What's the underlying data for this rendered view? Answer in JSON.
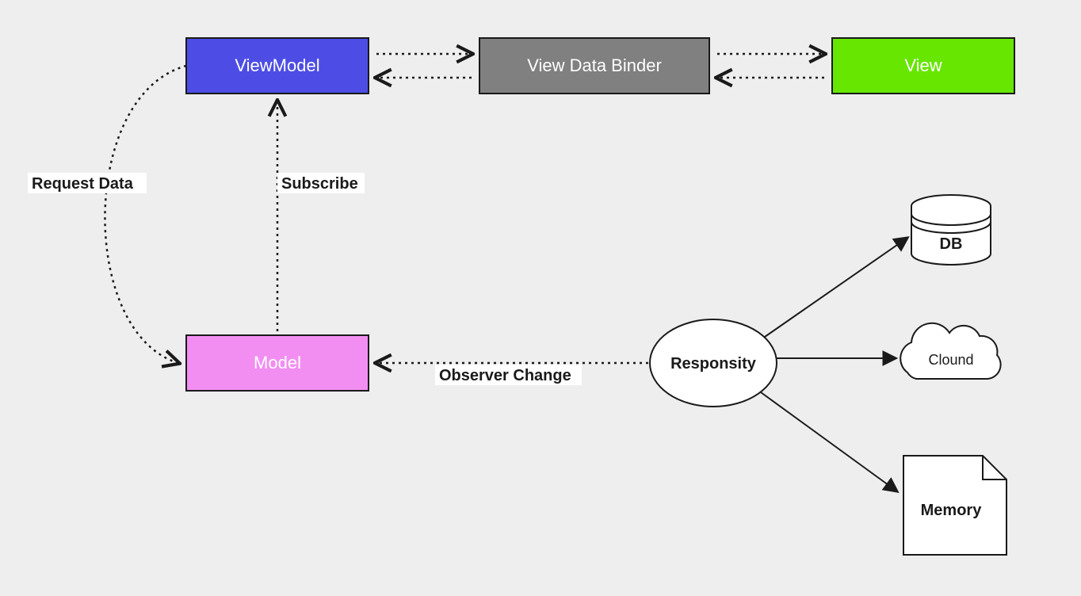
{
  "nodes": {
    "viewmodel": {
      "label": "ViewModel",
      "fill": "#4d4de6",
      "text": "#ffffff"
    },
    "binder": {
      "label": "View Data Binder",
      "fill": "#808080",
      "text": "#ffffff"
    },
    "view": {
      "label": "View",
      "fill": "#66e600",
      "text": "#ffffff"
    },
    "model": {
      "label": "Model",
      "fill": "#f28ef2",
      "text": "#ffffff"
    },
    "repo": {
      "label": "Responsity"
    },
    "db": {
      "label": "DB"
    },
    "cloud": {
      "label": "Clound"
    },
    "memory": {
      "label": "Memory"
    }
  },
  "edges": {
    "request_data": {
      "label": "Request Data"
    },
    "subscribe": {
      "label": "Subscribe"
    },
    "observer_change": {
      "label": "Observer Change"
    }
  }
}
